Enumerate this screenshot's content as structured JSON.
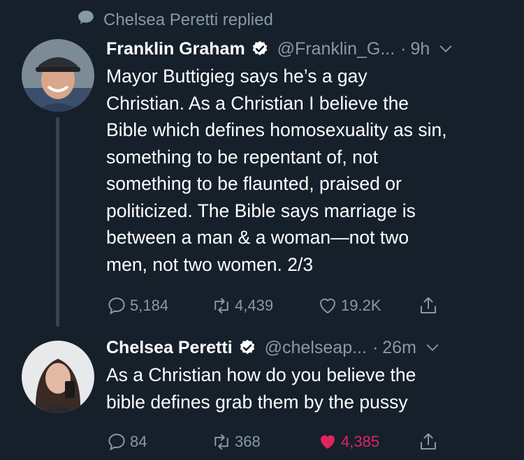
{
  "context": {
    "label": "Chelsea Peretti replied"
  },
  "tweets": [
    {
      "name": "Franklin Graham",
      "handle": "@Franklin_G...",
      "time": "9h",
      "text": "Mayor Buttigieg says he’s a gay\nChristian. As a Christian I believe the\nBible which defines homosexuality as sin,\nsomething to be repentant of, not\nsomething to be flaunted, praised or\npoliticized. The Bible says marriage is\nbetween a man & a woman—not two\nmen, not two women. 2/3",
      "replies": "5,184",
      "retweets": "4,439",
      "likes": "19.2K",
      "liked": false
    },
    {
      "name": "Chelsea Peretti",
      "handle": "@chelseap...",
      "time": "26m",
      "text": "As a Christian how do you believe the\nbible defines grab them by the pussy",
      "replies": "84",
      "retweets": "368",
      "likes": "4,385",
      "liked": true
    }
  ],
  "colors": {
    "background": "#15202b",
    "muted": "#8899a6",
    "verified": "#ffffff",
    "like_active": "#e0245e",
    "thread_line": "#38444d"
  },
  "icons": [
    "speech-bubble-icon",
    "verified-badge-icon",
    "chevron-down-icon",
    "reply-icon",
    "retweet-icon",
    "heart-icon",
    "share-icon"
  ]
}
